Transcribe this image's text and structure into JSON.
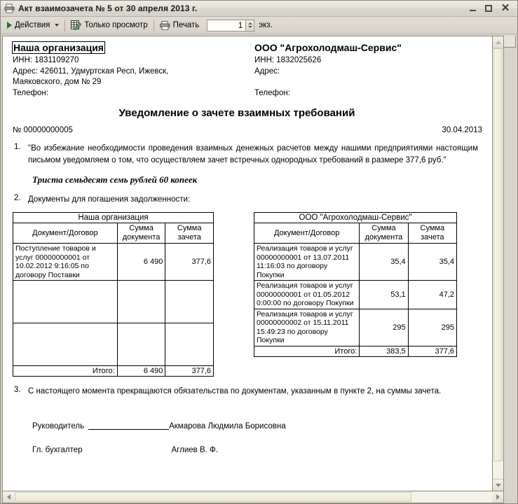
{
  "window": {
    "title": "Акт взаимозачета № 5 от 30 апреля 2013 г.",
    "title_icon": "printer-document-icon",
    "minimize_label": "_",
    "maximize_label": "□",
    "close_label": "✕"
  },
  "toolbar": {
    "actions_label": "Действия",
    "preview_label": "Только просмотр",
    "print_label": "Печать",
    "copies_value": "1",
    "copies_unit": "экз."
  },
  "document": {
    "our_org": {
      "name": "Наша организация",
      "inn": "ИНН: 1831109270",
      "address_line1": "Адрес: 426011, Удмуртская Респ, Ижевск,",
      "address_line2": "Маяковского, дом № 29",
      "phone": "Телефон:"
    },
    "counterparty": {
      "name": "ООО \"Агрохолодмаш-Сервис\"",
      "inn": "ИНН: 1832025626",
      "address": "Адрес:",
      "phone": "Телефон:"
    },
    "title": "Уведомление о зачете взаимных требований",
    "number": "№ 00000000005",
    "date": "30.04.2013",
    "clause1_num": "1.",
    "clause1_text": "\"Во избежание необходимости проведения взаимных денежных расчетов между нашими предприятиями настоящим письмом уведомляем о том, что осуществляем зачет встречных однородных требований в размере  377,6 руб.\"",
    "amount_in_words": "Триста семьдесят семь рублей 60 копеек",
    "clause2_num": "2.",
    "clause2_text": "Документы для погашения задолженности:",
    "clause3_num": "3.",
    "clause3_text": "С настоящего момента прекращаются обязательства по документам, указанным в пункте 2, на суммы зачета.",
    "table_left": {
      "caption": "Наша организация",
      "columns": [
        "Документ/Договор",
        "Сумма документа",
        "Сумма зачета"
      ],
      "rows": [
        {
          "doc": "Поступление товаров и услуг 00000000001 от 10.02.2012 9:16:05 по договору Поставки",
          "sum_doc": "6 490",
          "sum_offset": "377,6"
        },
        {
          "doc": "",
          "sum_doc": "",
          "sum_offset": ""
        },
        {
          "doc": "",
          "sum_doc": "",
          "sum_offset": ""
        }
      ],
      "total_label": "Итого:",
      "total_sum_doc": "6 490",
      "total_sum_offset": "377,6"
    },
    "table_right": {
      "caption": "ООО \"Агрохолодмаш-Сервис\"",
      "columns": [
        "Документ/Договор",
        "Сумма документа",
        "Сумма зачета"
      ],
      "rows": [
        {
          "doc": "Реализация товаров и услуг 00000000001 от 13.07.2011 11:16:03 по договору Покупки",
          "sum_doc": "35,4",
          "sum_offset": "35,4"
        },
        {
          "doc": "Реализация товаров и услуг 00000000001 от 01.05.2012 0:00:00 по договору Покупки",
          "sum_doc": "53,1",
          "sum_offset": "47,2"
        },
        {
          "doc": "Реализация товаров и услуг 00000000002 от 15.11.2011 15:49:23 по договору Покупки",
          "sum_doc": "295",
          "sum_offset": "295"
        }
      ],
      "total_label": "Итого:",
      "total_sum_doc": "383,5",
      "total_sum_offset": "377,6"
    },
    "signatures": [
      {
        "role": "Руководитель",
        "name": "Акмарова Людмила Борисовна"
      },
      {
        "role": "Гл. бухгалтер",
        "name": "Аглиев В. Ф."
      }
    ]
  }
}
